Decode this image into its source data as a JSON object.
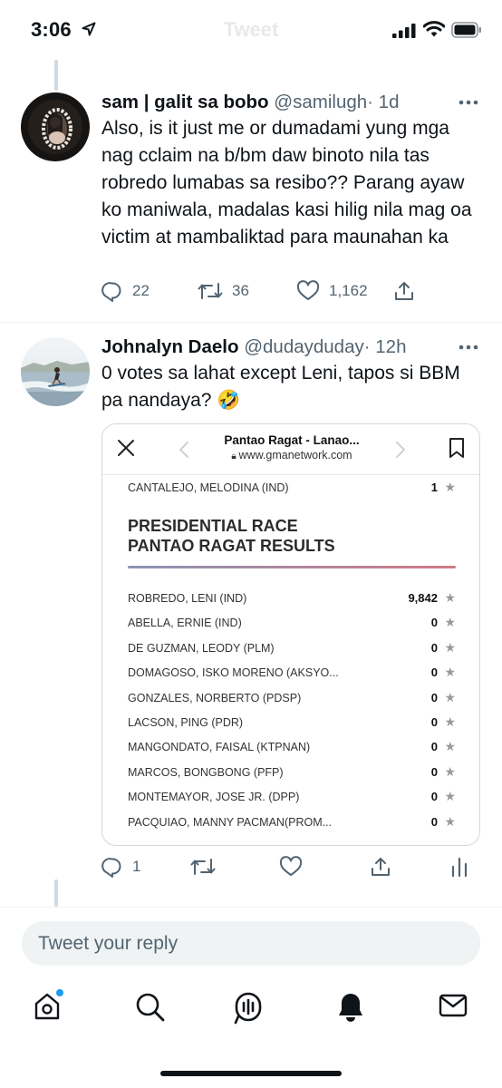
{
  "status_bar": {
    "time": "3:06",
    "faded_title": "Tweet"
  },
  "tweets": [
    {
      "name": "sam | galit sa bobo",
      "handle": "@samilugh",
      "age": "· 1d",
      "text": "Also, is it just me or dumadami yung mga nag cclaim na b/bm daw binoto nila tas robredo lumabas sa resibo?? Parang ayaw ko maniwala, madalas kasi hilig nila mag oa victim at mambaliktad para maunahan ka",
      "replies": "22",
      "retweets": "36",
      "likes": "1,162"
    },
    {
      "name": "Johnalyn Daelo",
      "handle": "@dudayduday",
      "age": "· 12h",
      "text": "0 votes sa lahat except Leni, tapos si BBM pa nandaya? 🤣",
      "replies": "1"
    }
  ],
  "card": {
    "title": "Pantao Ragat - Lanao...",
    "url": "www.gmanetwork.com",
    "prev_row": {
      "candidate": "CANTALEJO, MELODINA (IND)",
      "votes": "1"
    },
    "heading_line1": "PRESIDENTIAL RACE",
    "heading_line2": "PANTAO RAGAT RESULTS",
    "results": [
      {
        "candidate": "ROBREDO, LENI (IND)",
        "votes": "9,842"
      },
      {
        "candidate": "ABELLA, ERNIE (IND)",
        "votes": "0"
      },
      {
        "candidate": "DE GUZMAN, LEODY (PLM)",
        "votes": "0"
      },
      {
        "candidate": "DOMAGOSO, ISKO MORENO (AKSYO...",
        "votes": "0"
      },
      {
        "candidate": "GONZALES, NORBERTO (PDSP)",
        "votes": "0"
      },
      {
        "candidate": "LACSON, PING (PDR)",
        "votes": "0"
      },
      {
        "candidate": "MANGONDATO, FAISAL (KTPNAN)",
        "votes": "0"
      },
      {
        "candidate": "MARCOS, BONGBONG (PFP)",
        "votes": "0"
      },
      {
        "candidate": "MONTEMAYOR, JOSE JR. (DPP)",
        "votes": "0"
      },
      {
        "candidate": "PACQUIAO, MANNY PACMAN(PROM...",
        "votes": "0"
      }
    ],
    "star": "★"
  },
  "reply": {
    "placeholder": "Tweet your reply"
  },
  "colors": {
    "accent": "#1d9bf0",
    "text": "#0f1419",
    "secondary": "#536471",
    "rule_start": "#8a95b5",
    "rule_end": "#d27a86"
  },
  "icons": [
    "location-arrow-icon",
    "signal-icon",
    "wifi-icon",
    "battery-icon",
    "more-icon",
    "reply-icon",
    "retweet-icon",
    "like-icon",
    "share-icon",
    "analytics-icon",
    "close-icon",
    "back-chevron-icon",
    "forward-chevron-icon",
    "bookmark-icon",
    "home-icon",
    "search-icon",
    "spaces-icon",
    "notifications-icon",
    "messages-icon"
  ]
}
